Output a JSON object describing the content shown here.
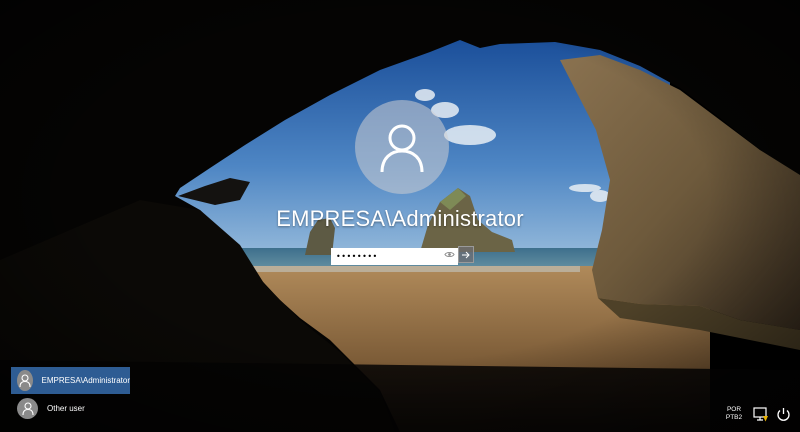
{
  "account": {
    "display_name": "EMPRESA\\Administrator"
  },
  "password": {
    "value": "••••••••"
  },
  "user_list": [
    {
      "label": "EMPRESA\\Administrator",
      "selected": true
    },
    {
      "label": "Other user",
      "selected": false
    }
  ],
  "tray": {
    "lang_line1": "POR",
    "lang_line2": "PTB2"
  },
  "icons": {
    "avatar": "user-silhouette-icon",
    "reveal": "eye-icon",
    "submit": "arrow-right-icon",
    "accessibility": "ease-of-access-icon",
    "network": "network-icon",
    "power": "power-icon"
  },
  "colors": {
    "selected_tile": "#2e5c93"
  }
}
